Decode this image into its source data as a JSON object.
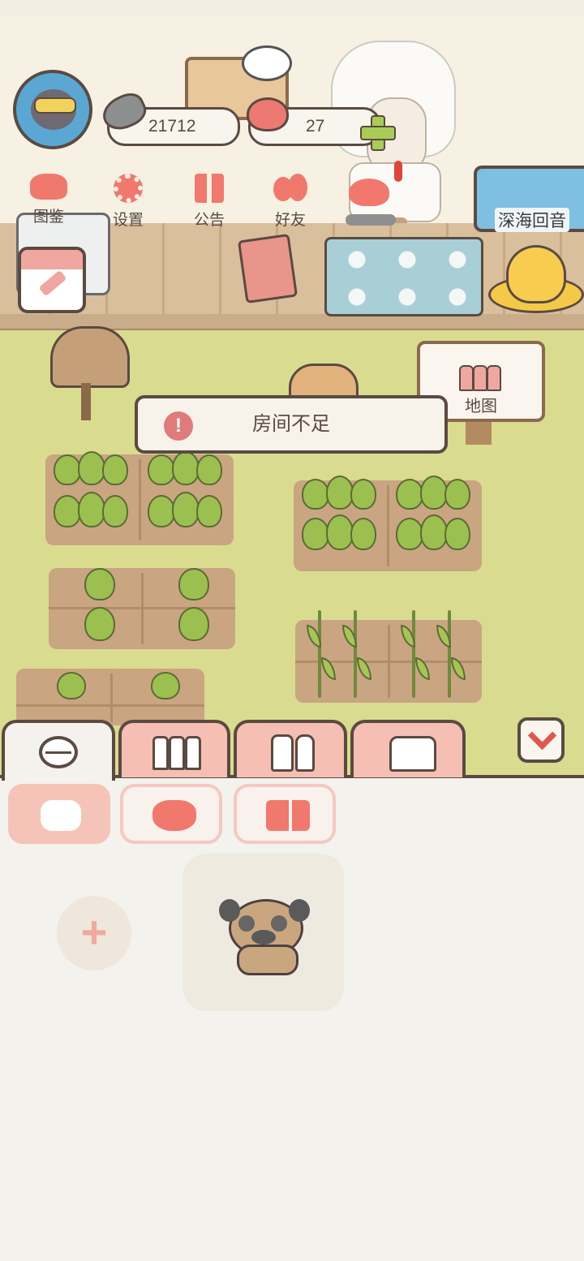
{
  "hud": {
    "fish_currency": "21712",
    "heart_currency": "27"
  },
  "menu": {
    "items": [
      {
        "label": "图鉴",
        "icon": "cat-book-icon"
      },
      {
        "label": "设置",
        "icon": "gear-icon"
      },
      {
        "label": "公告",
        "icon": "gift-icon"
      },
      {
        "label": "好友",
        "icon": "friends-icon"
      }
    ]
  },
  "event_banner": {
    "label": "深海回音"
  },
  "map_sign": {
    "label": "地图"
  },
  "toast": {
    "message": "房间不足"
  },
  "bottom_tabs": [
    {
      "name": "pets",
      "icon": "pet-face-icon",
      "active": true
    },
    {
      "name": "fences",
      "icon": "fence-icon",
      "active": false
    },
    {
      "name": "food",
      "icon": "utensils-icon",
      "active": false
    },
    {
      "name": "clothes",
      "icon": "shirt-icon",
      "active": false
    }
  ],
  "sub_tabs": [
    {
      "name": "sleeping-pet",
      "icon": "sleepy-pet-icon",
      "active": true
    },
    {
      "name": "cat",
      "icon": "cat-icon",
      "active": false
    },
    {
      "name": "door",
      "icon": "card-icon",
      "active": false
    }
  ],
  "inventory": {
    "add_slot_symbol": "+",
    "items": [
      {
        "icon": "pug-dog-icon"
      }
    ]
  },
  "colors": {
    "accent_pink": "#f5bfb3",
    "outline": "#5a4a42",
    "grass": "#d9dc8e",
    "alert_red": "#e07b7b"
  }
}
